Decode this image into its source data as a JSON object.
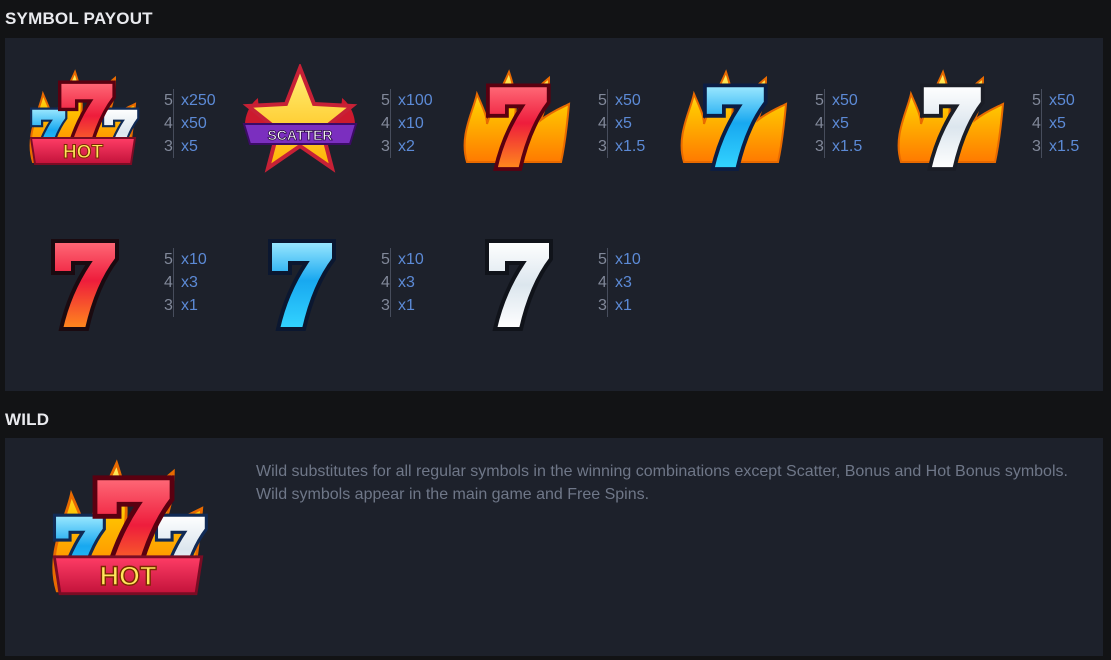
{
  "sections": {
    "symbol_payout": "SYMBOL PAYOUT",
    "wild": "WILD"
  },
  "payouts": [
    {
      "symbol": "hot-wild-icon",
      "rows": [
        {
          "count": "5",
          "mult": "x250"
        },
        {
          "count": "4",
          "mult": "x50"
        },
        {
          "count": "3",
          "mult": "x5"
        }
      ]
    },
    {
      "symbol": "scatter-star-icon",
      "rows": [
        {
          "count": "5",
          "mult": "x100"
        },
        {
          "count": "4",
          "mult": "x10"
        },
        {
          "count": "3",
          "mult": "x2"
        }
      ]
    },
    {
      "symbol": "flaming-red-seven-icon",
      "rows": [
        {
          "count": "5",
          "mult": "x50"
        },
        {
          "count": "4",
          "mult": "x5"
        },
        {
          "count": "3",
          "mult": "x1.5"
        }
      ]
    },
    {
      "symbol": "flaming-blue-seven-icon",
      "rows": [
        {
          "count": "5",
          "mult": "x50"
        },
        {
          "count": "4",
          "mult": "x5"
        },
        {
          "count": "3",
          "mult": "x1.5"
        }
      ]
    },
    {
      "symbol": "flaming-white-seven-icon",
      "rows": [
        {
          "count": "5",
          "mult": "x50"
        },
        {
          "count": "4",
          "mult": "x5"
        },
        {
          "count": "3",
          "mult": "x1.5"
        }
      ]
    },
    {
      "symbol": "red-seven-icon",
      "rows": [
        {
          "count": "5",
          "mult": "x10"
        },
        {
          "count": "4",
          "mult": "x3"
        },
        {
          "count": "3",
          "mult": "x1"
        }
      ]
    },
    {
      "symbol": "blue-seven-icon",
      "rows": [
        {
          "count": "5",
          "mult": "x10"
        },
        {
          "count": "4",
          "mult": "x3"
        },
        {
          "count": "3",
          "mult": "x1"
        }
      ]
    },
    {
      "symbol": "white-seven-icon",
      "rows": [
        {
          "count": "5",
          "mult": "x10"
        },
        {
          "count": "4",
          "mult": "x3"
        },
        {
          "count": "3",
          "mult": "x1"
        }
      ]
    }
  ],
  "symbol_labels": {
    "hot": "HOT",
    "scatter": "SCATTER"
  },
  "wild": {
    "symbol": "hot-wild-icon",
    "description": [
      "Wild substitutes for all regular symbols in the winning combinations except Scatter, Bonus and Hot Bonus symbols.",
      "Wild symbols appear in the main game and Free Spins."
    ]
  },
  "colors": {
    "background": "#121315",
    "panel": "#1d212b",
    "multiplier": "#5c8ad6",
    "count": "#818899",
    "description": "#6f7788"
  }
}
